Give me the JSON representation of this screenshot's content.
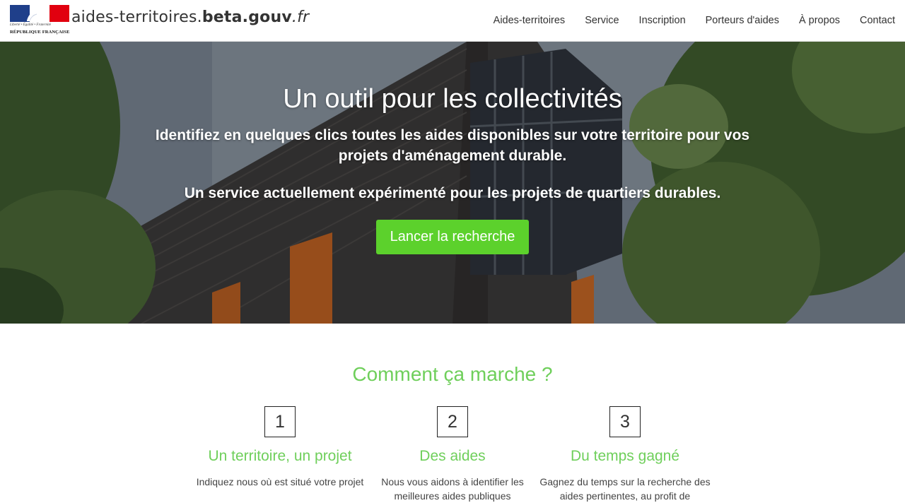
{
  "header": {
    "devise": "Liberté • Égalité • Fraternité",
    "republique": "RÉPUBLIQUE FRANÇAISE",
    "site_name_prefix": "aides-territoires.",
    "site_name_domain": "beta.gouv",
    "site_name_tld": ".fr",
    "nav": [
      "Aides-territoires",
      "Service",
      "Inscription",
      "Porteurs d'aides",
      "À propos",
      "Contact"
    ]
  },
  "hero": {
    "title": "Un outil pour les collectivités",
    "subtitle": "Identifiez en quelques clics toutes les aides disponibles sur votre territoire pour vos projets d'aménagement durable.",
    "subtitle2": "Un service actuellement expérimenté pour les projets de quartiers durables.",
    "cta_label": "Lancer la recherche"
  },
  "how": {
    "title": "Comment ça marche ?",
    "steps": [
      {
        "number": "1",
        "title": "Un territoire, un projet",
        "text": "Indiquez nous où est situé votre projet"
      },
      {
        "number": "2",
        "title": "Des aides",
        "text": "Nous vous aidons à identifier les meilleures aides publiques"
      },
      {
        "number": "3",
        "title": "Du temps gagné",
        "text": "Gagnez du temps sur la recherche des aides pertinentes, au profit de"
      }
    ]
  },
  "colors": {
    "accent_green": "#6fcf5b",
    "cta_green": "#5cd12c",
    "flag_blue": "#1f3f8a",
    "flag_red": "#e1000f"
  }
}
